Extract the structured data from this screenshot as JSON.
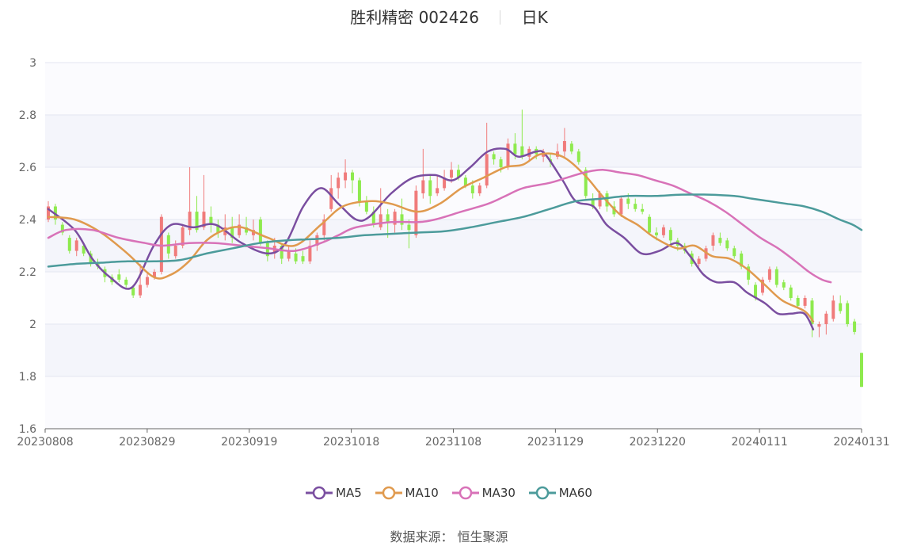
{
  "chart_data": {
    "type": "candlestick",
    "title": "胜利精密 002426",
    "period_label": "日K",
    "ylim": [
      1.6,
      3.0
    ],
    "y_ticks": [
      "3",
      "2.8",
      "2.6",
      "2.4",
      "2.2",
      "2",
      "1.8",
      "1.6"
    ],
    "x_tick_labels": [
      "20230808",
      "20230829",
      "20230919",
      "20231018",
      "20231108",
      "20231129",
      "20231220",
      "20240111",
      "20240131"
    ],
    "grid": true,
    "colors": {
      "up": "#f07b7b",
      "down": "#8eea4e",
      "MA5": "#7a4ea0",
      "MA10": "#e09a4e",
      "MA30": "#d872b8",
      "MA60": "#4c9b9b"
    },
    "candles": [
      [
        2.4,
        2.45,
        2.47,
        2.39
      ],
      [
        2.45,
        2.4,
        2.46,
        2.38
      ],
      [
        2.38,
        2.35,
        2.39,
        2.34
      ],
      [
        2.33,
        2.28,
        2.34,
        2.27
      ],
      [
        2.28,
        2.32,
        2.33,
        2.26
      ],
      [
        2.3,
        2.27,
        2.31,
        2.26
      ],
      [
        2.27,
        2.23,
        2.28,
        2.22
      ],
      [
        2.23,
        2.22,
        2.25,
        2.21
      ],
      [
        2.21,
        2.18,
        2.22,
        2.16
      ],
      [
        2.18,
        2.16,
        2.19,
        2.15
      ],
      [
        2.19,
        2.17,
        2.21,
        2.16
      ],
      [
        2.17,
        2.15,
        2.18,
        2.14
      ],
      [
        2.14,
        2.11,
        2.15,
        2.1
      ],
      [
        2.11,
        2.15,
        2.23,
        2.1
      ],
      [
        2.15,
        2.18,
        2.2,
        2.14
      ],
      [
        2.18,
        2.2,
        2.21,
        2.17
      ],
      [
        2.2,
        2.41,
        2.42,
        2.19
      ],
      [
        2.34,
        2.27,
        2.35,
        2.25
      ],
      [
        2.26,
        2.3,
        2.32,
        2.25
      ],
      [
        2.3,
        2.37,
        2.38,
        2.29
      ],
      [
        2.36,
        2.43,
        2.6,
        2.34
      ],
      [
        2.43,
        2.36,
        2.49,
        2.35
      ],
      [
        2.37,
        2.43,
        2.57,
        2.36
      ],
      [
        2.41,
        2.38,
        2.45,
        2.35
      ],
      [
        2.38,
        2.35,
        2.4,
        2.33
      ],
      [
        2.34,
        2.37,
        2.42,
        2.32
      ],
      [
        2.37,
        2.33,
        2.41,
        2.31
      ],
      [
        2.34,
        2.38,
        2.42,
        2.33
      ],
      [
        2.37,
        2.35,
        2.41,
        2.34
      ],
      [
        2.34,
        2.36,
        2.4,
        2.32
      ],
      [
        2.4,
        2.31,
        2.41,
        2.3
      ],
      [
        2.31,
        2.26,
        2.32,
        2.24
      ],
      [
        2.27,
        2.3,
        2.33,
        2.25
      ],
      [
        2.3,
        2.25,
        2.31,
        2.23
      ],
      [
        2.25,
        2.28,
        2.3,
        2.24
      ],
      [
        2.27,
        2.24,
        2.29,
        2.23
      ],
      [
        2.26,
        2.24,
        2.28,
        2.23
      ],
      [
        2.24,
        2.3,
        2.32,
        2.23
      ],
      [
        2.3,
        2.34,
        2.35,
        2.28
      ],
      [
        2.34,
        2.4,
        2.42,
        2.32
      ],
      [
        2.44,
        2.52,
        2.57,
        2.43
      ],
      [
        2.52,
        2.56,
        2.58,
        2.48
      ],
      [
        2.55,
        2.58,
        2.63,
        2.52
      ],
      [
        2.58,
        2.55,
        2.59,
        2.5
      ],
      [
        2.55,
        2.47,
        2.56,
        2.45
      ],
      [
        2.47,
        2.43,
        2.49,
        2.42
      ],
      [
        2.43,
        2.38,
        2.45,
        2.37
      ],
      [
        2.37,
        2.42,
        2.52,
        2.36
      ],
      [
        2.42,
        2.39,
        2.44,
        2.33
      ],
      [
        2.38,
        2.43,
        2.44,
        2.35
      ],
      [
        2.42,
        2.38,
        2.48,
        2.36
      ],
      [
        2.38,
        2.36,
        2.4,
        2.29
      ],
      [
        2.34,
        2.51,
        2.53,
        2.33
      ],
      [
        2.5,
        2.55,
        2.67,
        2.48
      ],
      [
        2.55,
        2.49,
        2.57,
        2.46
      ],
      [
        2.5,
        2.52,
        2.57,
        2.49
      ],
      [
        2.52,
        2.56,
        2.59,
        2.51
      ],
      [
        2.56,
        2.59,
        2.62,
        2.54
      ],
      [
        2.59,
        2.56,
        2.61,
        2.55
      ],
      [
        2.56,
        2.53,
        2.57,
        2.52
      ],
      [
        2.53,
        2.5,
        2.55,
        2.48
      ],
      [
        2.5,
        2.53,
        2.54,
        2.49
      ],
      [
        2.53,
        2.65,
        2.77,
        2.52
      ],
      [
        2.65,
        2.63,
        2.66,
        2.61
      ],
      [
        2.63,
        2.6,
        2.64,
        2.58
      ],
      [
        2.6,
        2.69,
        2.71,
        2.59
      ],
      [
        2.69,
        2.65,
        2.73,
        2.63
      ],
      [
        2.68,
        2.64,
        2.82,
        2.63
      ],
      [
        2.64,
        2.67,
        2.68,
        2.62
      ],
      [
        2.67,
        2.65,
        2.68,
        2.63
      ],
      [
        2.64,
        2.66,
        2.67,
        2.62
      ],
      [
        2.63,
        2.62,
        2.65,
        2.6
      ],
      [
        2.64,
        2.66,
        2.69,
        2.63
      ],
      [
        2.66,
        2.7,
        2.75,
        2.64
      ],
      [
        2.69,
        2.66,
        2.7,
        2.65
      ],
      [
        2.66,
        2.62,
        2.67,
        2.61
      ],
      [
        2.59,
        2.49,
        2.6,
        2.48
      ],
      [
        2.48,
        2.45,
        2.5,
        2.44
      ],
      [
        2.45,
        2.5,
        2.51,
        2.44
      ],
      [
        2.5,
        2.45,
        2.51,
        2.43
      ],
      [
        2.45,
        2.42,
        2.47,
        2.41
      ],
      [
        2.42,
        2.48,
        2.49,
        2.41
      ],
      [
        2.48,
        2.46,
        2.5,
        2.44
      ],
      [
        2.46,
        2.44,
        2.48,
        2.43
      ],
      [
        2.44,
        2.43,
        2.46,
        2.42
      ],
      [
        2.41,
        2.35,
        2.42,
        2.34
      ],
      [
        2.35,
        2.34,
        2.37,
        2.32
      ],
      [
        2.34,
        2.37,
        2.38,
        2.33
      ],
      [
        2.36,
        2.32,
        2.37,
        2.3
      ],
      [
        2.32,
        2.3,
        2.33,
        2.28
      ],
      [
        2.3,
        2.28,
        2.31,
        2.27
      ],
      [
        2.27,
        2.23,
        2.28,
        2.22
      ],
      [
        2.23,
        2.25,
        2.26,
        2.22
      ],
      [
        2.25,
        2.29,
        2.3,
        2.24
      ],
      [
        2.3,
        2.34,
        2.35,
        2.28
      ],
      [
        2.33,
        2.31,
        2.35,
        2.3
      ],
      [
        2.32,
        2.29,
        2.33,
        2.28
      ],
      [
        2.29,
        2.26,
        2.3,
        2.25
      ],
      [
        2.27,
        2.22,
        2.28,
        2.21
      ],
      [
        2.22,
        2.17,
        2.23,
        2.15
      ],
      [
        2.15,
        2.1,
        2.16,
        2.09
      ],
      [
        2.12,
        2.17,
        2.18,
        2.11
      ],
      [
        2.17,
        2.21,
        2.22,
        2.16
      ],
      [
        2.21,
        2.15,
        2.22,
        2.14
      ],
      [
        2.16,
        2.14,
        2.17,
        2.13
      ],
      [
        2.14,
        2.1,
        2.15,
        2.09
      ],
      [
        2.1,
        2.07,
        2.11,
        2.06
      ],
      [
        2.07,
        2.1,
        2.11,
        2.06
      ],
      [
        2.09,
        2.0,
        2.1,
        1.95
      ],
      [
        1.99,
        2.0,
        2.01,
        1.95
      ],
      [
        2.0,
        2.04,
        2.05,
        1.96
      ],
      [
        2.02,
        2.09,
        2.11,
        2.01
      ],
      [
        2.08,
        2.05,
        2.11,
        2.04
      ],
      [
        2.08,
        2.0,
        2.09,
        1.99
      ],
      [
        2.01,
        1.97,
        2.02,
        1.96
      ],
      [
        1.89,
        1.76,
        1.89,
        1.76
      ]
    ],
    "ma_series": [
      {
        "name": "MA5",
        "values": [
          [
            0,
            2.44
          ],
          [
            6,
            2.36
          ],
          [
            10,
            2.25
          ],
          [
            14,
            2.18
          ],
          [
            19,
            2.14
          ],
          [
            24,
            2.3
          ],
          [
            28,
            2.38
          ],
          [
            33,
            2.37
          ],
          [
            38,
            2.38
          ],
          [
            44,
            2.31
          ],
          [
            50,
            2.27
          ],
          [
            54,
            2.31
          ],
          [
            58,
            2.45
          ],
          [
            62,
            2.52
          ],
          [
            66,
            2.46
          ],
          [
            70,
            2.4
          ],
          [
            73,
            2.41
          ],
          [
            78,
            2.5
          ],
          [
            83,
            2.56
          ],
          [
            88,
            2.57
          ],
          [
            92,
            2.55
          ],
          [
            96,
            2.6
          ],
          [
            100,
            2.66
          ],
          [
            104,
            2.67
          ],
          [
            107,
            2.64
          ],
          [
            111,
            2.66
          ],
          [
            113,
            2.65
          ],
          [
            117,
            2.55
          ],
          [
            120,
            2.47
          ],
          [
            124,
            2.45
          ],
          [
            127,
            2.38
          ],
          [
            131,
            2.33
          ],
          [
            135,
            2.27
          ],
          [
            139,
            2.28
          ],
          [
            143,
            2.31
          ],
          [
            146,
            2.26
          ],
          [
            149,
            2.19
          ],
          [
            152,
            2.16
          ],
          [
            156,
            2.16
          ],
          [
            159,
            2.12
          ],
          [
            163,
            2.08
          ],
          [
            166,
            2.04
          ],
          [
            169,
            2.04
          ],
          [
            172,
            2.04
          ],
          [
            174,
            1.98
          ]
        ]
      },
      {
        "name": "MA10",
        "values": [
          [
            0,
            2.41
          ],
          [
            6,
            2.4
          ],
          [
            12,
            2.35
          ],
          [
            18,
            2.27
          ],
          [
            24,
            2.18
          ],
          [
            28,
            2.19
          ],
          [
            32,
            2.24
          ],
          [
            36,
            2.32
          ],
          [
            40,
            2.36
          ],
          [
            44,
            2.37
          ],
          [
            50,
            2.33
          ],
          [
            56,
            2.3
          ],
          [
            62,
            2.38
          ],
          [
            67,
            2.45
          ],
          [
            73,
            2.47
          ],
          [
            78,
            2.46
          ],
          [
            84,
            2.43
          ],
          [
            89,
            2.46
          ],
          [
            94,
            2.52
          ],
          [
            99,
            2.56
          ],
          [
            104,
            2.6
          ],
          [
            108,
            2.61
          ],
          [
            112,
            2.65
          ],
          [
            117,
            2.64
          ],
          [
            122,
            2.57
          ],
          [
            126,
            2.49
          ],
          [
            130,
            2.42
          ],
          [
            134,
            2.38
          ],
          [
            138,
            2.33
          ],
          [
            143,
            2.29
          ],
          [
            147,
            2.3
          ],
          [
            151,
            2.26
          ],
          [
            155,
            2.25
          ],
          [
            159,
            2.21
          ],
          [
            163,
            2.15
          ],
          [
            167,
            2.09
          ],
          [
            172,
            2.05
          ],
          [
            174,
            2.01
          ]
        ]
      },
      {
        "name": "MA30",
        "values": [
          [
            0,
            2.33
          ],
          [
            4,
            2.36
          ],
          [
            10,
            2.36
          ],
          [
            16,
            2.33
          ],
          [
            22,
            2.31
          ],
          [
            26,
            2.3
          ],
          [
            32,
            2.31
          ],
          [
            38,
            2.31
          ],
          [
            44,
            2.3
          ],
          [
            50,
            2.29
          ],
          [
            56,
            2.28
          ],
          [
            62,
            2.31
          ],
          [
            66,
            2.34
          ],
          [
            70,
            2.37
          ],
          [
            78,
            2.39
          ],
          [
            84,
            2.39
          ],
          [
            88,
            2.4
          ],
          [
            94,
            2.43
          ],
          [
            100,
            2.46
          ],
          [
            104,
            2.49
          ],
          [
            108,
            2.52
          ],
          [
            114,
            2.54
          ],
          [
            118,
            2.56
          ],
          [
            122,
            2.58
          ],
          [
            126,
            2.59
          ],
          [
            130,
            2.58
          ],
          [
            134,
            2.57
          ],
          [
            138,
            2.55
          ],
          [
            142,
            2.53
          ],
          [
            146,
            2.5
          ],
          [
            150,
            2.47
          ],
          [
            154,
            2.43
          ],
          [
            158,
            2.38
          ],
          [
            162,
            2.33
          ],
          [
            166,
            2.29
          ],
          [
            170,
            2.24
          ],
          [
            173,
            2.2
          ],
          [
            176,
            2.17
          ],
          [
            178,
            2.16
          ]
        ]
      },
      {
        "name": "MA60",
        "values": [
          [
            0,
            2.22
          ],
          [
            6,
            2.23
          ],
          [
            12,
            2.235
          ],
          [
            18,
            2.24
          ],
          [
            24,
            2.24
          ],
          [
            30,
            2.245
          ],
          [
            36,
            2.27
          ],
          [
            42,
            2.29
          ],
          [
            48,
            2.31
          ],
          [
            54,
            2.32
          ],
          [
            60,
            2.325
          ],
          [
            66,
            2.33
          ],
          [
            72,
            2.34
          ],
          [
            78,
            2.345
          ],
          [
            84,
            2.35
          ],
          [
            90,
            2.355
          ],
          [
            96,
            2.37
          ],
          [
            102,
            2.39
          ],
          [
            108,
            2.41
          ],
          [
            114,
            2.44
          ],
          [
            120,
            2.47
          ],
          [
            126,
            2.48
          ],
          [
            132,
            2.49
          ],
          [
            138,
            2.49
          ],
          [
            144,
            2.495
          ],
          [
            150,
            2.495
          ],
          [
            156,
            2.49
          ],
          [
            160,
            2.48
          ],
          [
            164,
            2.47
          ],
          [
            168,
            2.46
          ],
          [
            172,
            2.45
          ],
          [
            176,
            2.43
          ],
          [
            180,
            2.4
          ],
          [
            183,
            2.38
          ],
          [
            185,
            2.36
          ]
        ]
      }
    ]
  },
  "legend": {
    "items": [
      {
        "label": "MA5"
      },
      {
        "label": "MA10"
      },
      {
        "label": "MA30"
      },
      {
        "label": "MA60"
      }
    ]
  },
  "footer": {
    "source_label": "数据来源：",
    "source_value": "恒生聚源"
  }
}
